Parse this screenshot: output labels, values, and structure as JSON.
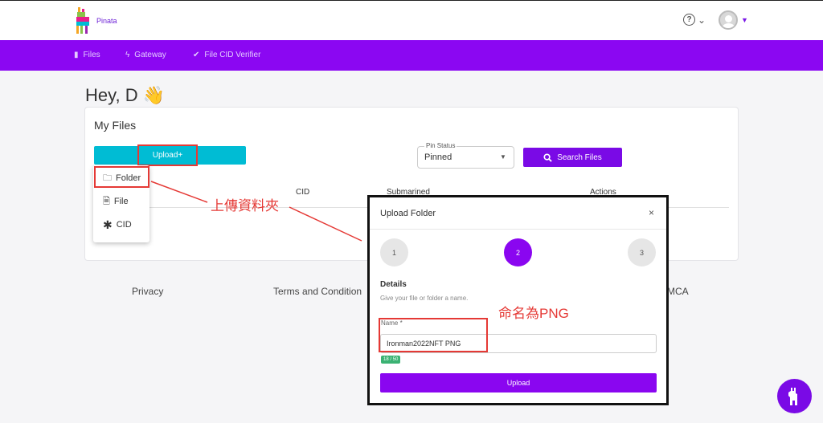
{
  "header": {
    "brand": "Pinata",
    "help_icon": "question-circle-icon",
    "avatar_icon": "user-avatar-icon"
  },
  "nav": {
    "items": [
      {
        "label": "Files",
        "icon": "file-icon"
      },
      {
        "label": "Gateway",
        "icon": "lightning-icon"
      },
      {
        "label": "File CID Verifier",
        "icon": "double-check-icon"
      }
    ]
  },
  "main": {
    "greeting": "Hey, D",
    "greeting_emoji": "👋",
    "card_title": "My Files",
    "upload_label": "Upload",
    "upload_plus": "+",
    "pin_status": {
      "label": "Pin Status",
      "value": "Pinned"
    },
    "search_button": "Search Files",
    "table_headers": [
      "CID",
      "Submarined",
      "Actions"
    ]
  },
  "upload_menu": {
    "items": [
      {
        "label": "Folder",
        "icon": "folder-icon"
      },
      {
        "label": "File",
        "icon": "document-icon"
      },
      {
        "label": "CID",
        "icon": "asterisk-icon"
      }
    ]
  },
  "annotations": {
    "upload_folder_note": "上傳資料夾",
    "name_note": "命名為PNG"
  },
  "footer": {
    "links": [
      "Privacy",
      "Terms and Condition",
      "MCA"
    ]
  },
  "modal": {
    "title": "Upload Folder",
    "close": "×",
    "steps": [
      "1",
      "2",
      "3"
    ],
    "details_title": "Details",
    "details_sub": "Give your file or folder a name.",
    "name_label": "Name *",
    "name_value": "Ironman2022NFT PNG",
    "char_count": "18 / 50",
    "upload_button": "Upload"
  },
  "colors": {
    "primary": "#8b07f2",
    "cyan": "#00bcd4",
    "annotation": "#e53935",
    "success": "#3bb273"
  }
}
